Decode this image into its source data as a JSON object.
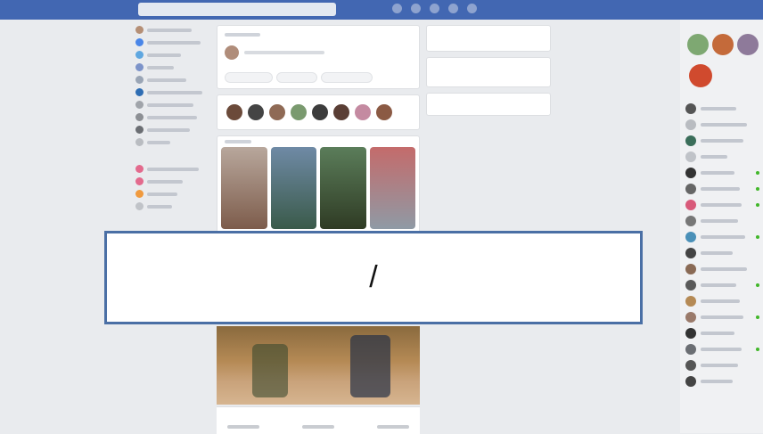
{
  "colors": {
    "topbar": "#4267b2",
    "background": "#e9ebee",
    "overlay_border": "#4a6fa5",
    "online": "#42b72a"
  },
  "icons": [
    "search-icon",
    "home-icon",
    "friends-icon",
    "messages-icon",
    "notifications-icon"
  ],
  "overlay": {
    "text": "/"
  }
}
